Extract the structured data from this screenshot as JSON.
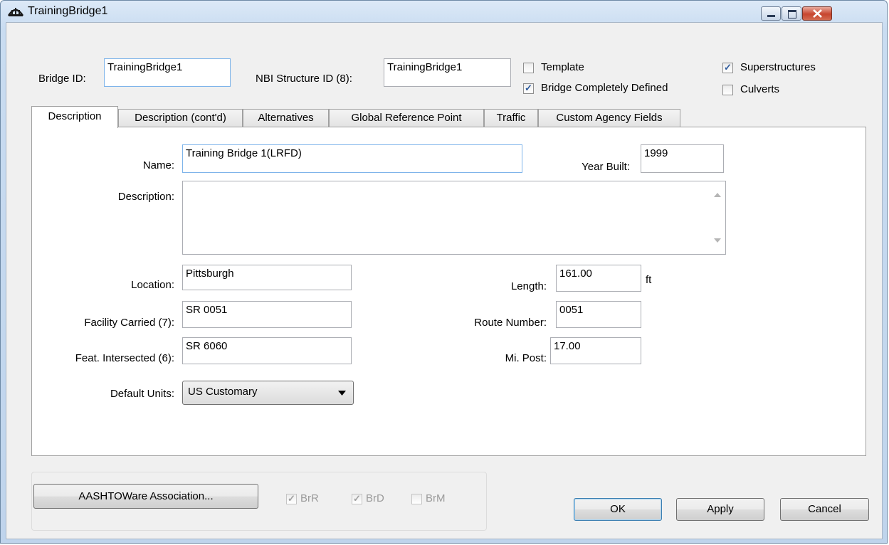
{
  "window": {
    "title": "TrainingBridge1"
  },
  "header": {
    "bridge_id_label": "Bridge ID:",
    "bridge_id_value": "TrainingBridge1",
    "nbi_label": "NBI Structure ID (8):",
    "nbi_value": "TrainingBridge1",
    "template_label": "Template",
    "template_checked": false,
    "completely_defined_label": "Bridge Completely Defined",
    "completely_defined_checked": true,
    "superstructures_label": "Superstructures",
    "superstructures_checked": true,
    "culverts_label": "Culverts",
    "culverts_checked": false
  },
  "tabs": [
    {
      "label": "Description",
      "active": true
    },
    {
      "label": "Description (cont'd)",
      "active": false
    },
    {
      "label": "Alternatives",
      "active": false
    },
    {
      "label": "Global Reference Point",
      "active": false
    },
    {
      "label": "Traffic",
      "active": false
    },
    {
      "label": "Custom Agency Fields",
      "active": false
    }
  ],
  "description_tab": {
    "name_label": "Name:",
    "name_value": "Training Bridge 1(LRFD)",
    "year_built_label": "Year Built:",
    "year_built_value": "1999",
    "description_label": "Description:",
    "description_value": "",
    "location_label": "Location:",
    "location_value": "Pittsburgh",
    "length_label": "Length:",
    "length_value": "161.00",
    "length_unit": "ft",
    "facility_label": "Facility Carried (7):",
    "facility_value": "SR 0051",
    "route_label": "Route Number:",
    "route_value": "0051",
    "feat_label": "Feat. Intersected (6):",
    "feat_value": "SR 6060",
    "mipost_label": "Mi. Post:",
    "mipost_value": "17.00",
    "units_label": "Default Units:",
    "units_value": "US Customary"
  },
  "footer": {
    "association_button": "AASHTOWare Association...",
    "brr_label": "BrR",
    "brd_label": "BrD",
    "brm_label": "BrM",
    "ok_button": "OK",
    "apply_button": "Apply",
    "cancel_button": "Cancel"
  },
  "colors": {
    "window_frame": "#bfd4ec",
    "close_button": "#c7452e",
    "focus_border": "#7eb4ea"
  }
}
